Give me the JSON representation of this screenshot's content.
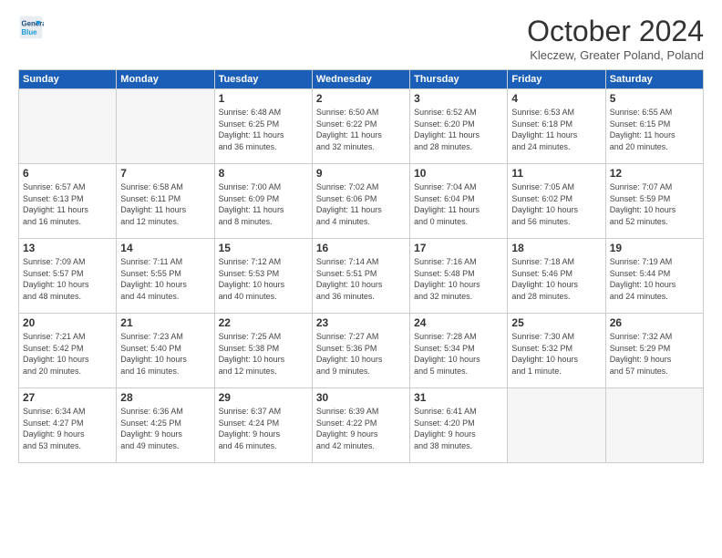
{
  "logo": {
    "line1": "General",
    "line2": "Blue"
  },
  "title": "October 2024",
  "subtitle": "Kleczew, Greater Poland, Poland",
  "days_header": [
    "Sunday",
    "Monday",
    "Tuesday",
    "Wednesday",
    "Thursday",
    "Friday",
    "Saturday"
  ],
  "weeks": [
    [
      {
        "day": "",
        "info": ""
      },
      {
        "day": "",
        "info": ""
      },
      {
        "day": "1",
        "info": "Sunrise: 6:48 AM\nSunset: 6:25 PM\nDaylight: 11 hours\nand 36 minutes."
      },
      {
        "day": "2",
        "info": "Sunrise: 6:50 AM\nSunset: 6:22 PM\nDaylight: 11 hours\nand 32 minutes."
      },
      {
        "day": "3",
        "info": "Sunrise: 6:52 AM\nSunset: 6:20 PM\nDaylight: 11 hours\nand 28 minutes."
      },
      {
        "day": "4",
        "info": "Sunrise: 6:53 AM\nSunset: 6:18 PM\nDaylight: 11 hours\nand 24 minutes."
      },
      {
        "day": "5",
        "info": "Sunrise: 6:55 AM\nSunset: 6:15 PM\nDaylight: 11 hours\nand 20 minutes."
      }
    ],
    [
      {
        "day": "6",
        "info": "Sunrise: 6:57 AM\nSunset: 6:13 PM\nDaylight: 11 hours\nand 16 minutes."
      },
      {
        "day": "7",
        "info": "Sunrise: 6:58 AM\nSunset: 6:11 PM\nDaylight: 11 hours\nand 12 minutes."
      },
      {
        "day": "8",
        "info": "Sunrise: 7:00 AM\nSunset: 6:09 PM\nDaylight: 11 hours\nand 8 minutes."
      },
      {
        "day": "9",
        "info": "Sunrise: 7:02 AM\nSunset: 6:06 PM\nDaylight: 11 hours\nand 4 minutes."
      },
      {
        "day": "10",
        "info": "Sunrise: 7:04 AM\nSunset: 6:04 PM\nDaylight: 11 hours\nand 0 minutes."
      },
      {
        "day": "11",
        "info": "Sunrise: 7:05 AM\nSunset: 6:02 PM\nDaylight: 10 hours\nand 56 minutes."
      },
      {
        "day": "12",
        "info": "Sunrise: 7:07 AM\nSunset: 5:59 PM\nDaylight: 10 hours\nand 52 minutes."
      }
    ],
    [
      {
        "day": "13",
        "info": "Sunrise: 7:09 AM\nSunset: 5:57 PM\nDaylight: 10 hours\nand 48 minutes."
      },
      {
        "day": "14",
        "info": "Sunrise: 7:11 AM\nSunset: 5:55 PM\nDaylight: 10 hours\nand 44 minutes."
      },
      {
        "day": "15",
        "info": "Sunrise: 7:12 AM\nSunset: 5:53 PM\nDaylight: 10 hours\nand 40 minutes."
      },
      {
        "day": "16",
        "info": "Sunrise: 7:14 AM\nSunset: 5:51 PM\nDaylight: 10 hours\nand 36 minutes."
      },
      {
        "day": "17",
        "info": "Sunrise: 7:16 AM\nSunset: 5:48 PM\nDaylight: 10 hours\nand 32 minutes."
      },
      {
        "day": "18",
        "info": "Sunrise: 7:18 AM\nSunset: 5:46 PM\nDaylight: 10 hours\nand 28 minutes."
      },
      {
        "day": "19",
        "info": "Sunrise: 7:19 AM\nSunset: 5:44 PM\nDaylight: 10 hours\nand 24 minutes."
      }
    ],
    [
      {
        "day": "20",
        "info": "Sunrise: 7:21 AM\nSunset: 5:42 PM\nDaylight: 10 hours\nand 20 minutes."
      },
      {
        "day": "21",
        "info": "Sunrise: 7:23 AM\nSunset: 5:40 PM\nDaylight: 10 hours\nand 16 minutes."
      },
      {
        "day": "22",
        "info": "Sunrise: 7:25 AM\nSunset: 5:38 PM\nDaylight: 10 hours\nand 12 minutes."
      },
      {
        "day": "23",
        "info": "Sunrise: 7:27 AM\nSunset: 5:36 PM\nDaylight: 10 hours\nand 9 minutes."
      },
      {
        "day": "24",
        "info": "Sunrise: 7:28 AM\nSunset: 5:34 PM\nDaylight: 10 hours\nand 5 minutes."
      },
      {
        "day": "25",
        "info": "Sunrise: 7:30 AM\nSunset: 5:32 PM\nDaylight: 10 hours\nand 1 minute."
      },
      {
        "day": "26",
        "info": "Sunrise: 7:32 AM\nSunset: 5:29 PM\nDaylight: 9 hours\nand 57 minutes."
      }
    ],
    [
      {
        "day": "27",
        "info": "Sunrise: 6:34 AM\nSunset: 4:27 PM\nDaylight: 9 hours\nand 53 minutes."
      },
      {
        "day": "28",
        "info": "Sunrise: 6:36 AM\nSunset: 4:25 PM\nDaylight: 9 hours\nand 49 minutes."
      },
      {
        "day": "29",
        "info": "Sunrise: 6:37 AM\nSunset: 4:24 PM\nDaylight: 9 hours\nand 46 minutes."
      },
      {
        "day": "30",
        "info": "Sunrise: 6:39 AM\nSunset: 4:22 PM\nDaylight: 9 hours\nand 42 minutes."
      },
      {
        "day": "31",
        "info": "Sunrise: 6:41 AM\nSunset: 4:20 PM\nDaylight: 9 hours\nand 38 minutes."
      },
      {
        "day": "",
        "info": ""
      },
      {
        "day": "",
        "info": ""
      }
    ]
  ]
}
